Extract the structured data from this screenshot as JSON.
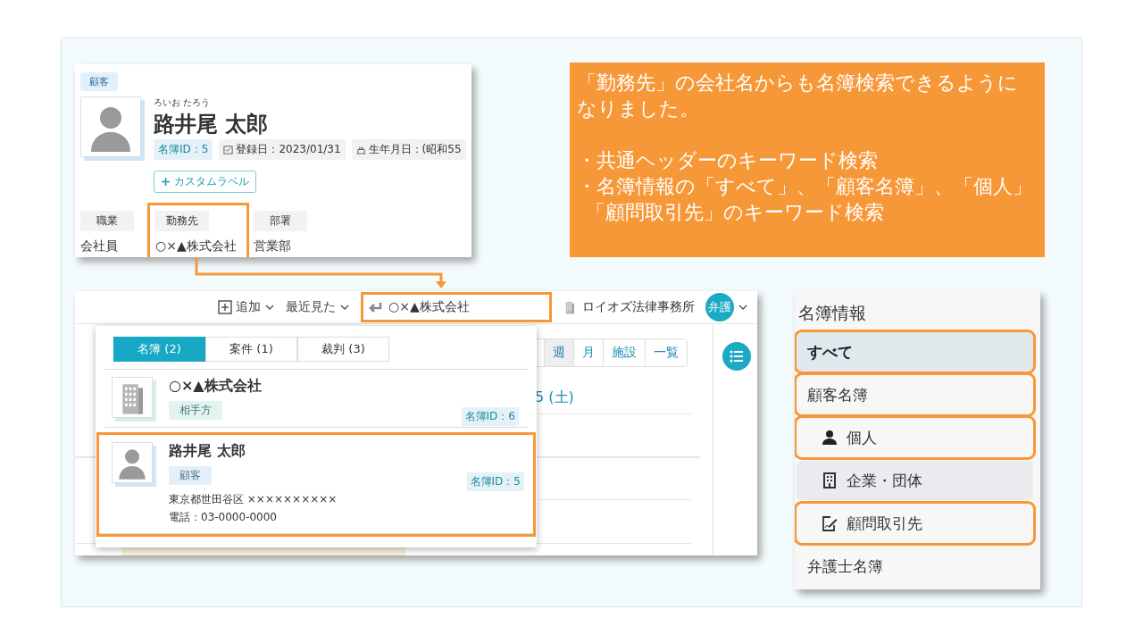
{
  "profile_card": {
    "category_badge": "顧客",
    "furigana": "ろいお たろう",
    "name": "路井尾 太郎",
    "meta": [
      {
        "kind": "id",
        "text": "名簿ID：5"
      },
      {
        "kind": "date",
        "text": "登録日：2023/01/31"
      },
      {
        "kind": "birthday",
        "text": "生年月日：(昭和55"
      }
    ],
    "custom_label_button": "カスタムラベル",
    "fields": [
      {
        "label": "職業",
        "value": "会社員",
        "highlighted": false
      },
      {
        "label": "勤務先",
        "value": "○×▲株式会社",
        "highlighted": true
      },
      {
        "label": "部署",
        "value": "営業部",
        "highlighted": false
      }
    ]
  },
  "callout": {
    "intro": "「勤務先」の会社名からも名簿検索できるようになりました。",
    "bullets": [
      [
        "・共通ヘッダーのキーワード検索"
      ],
      [
        "・名簿情報の「すべて」、「顧客名簿」、「個人」",
        "「顧問取引先」のキーワード検索"
      ]
    ]
  },
  "app_header": {
    "add_menu": "追加",
    "recent_menu": "最近見た",
    "search": {
      "value": "○×▲株式会社",
      "highlighted": true
    },
    "office": "ロイオズ法律事務所",
    "avatar": "弁護"
  },
  "calendar": {
    "views": [
      {
        "label": "週",
        "selected": true
      },
      {
        "label": "月",
        "selected": false
      },
      {
        "label": "施設",
        "selected": false
      },
      {
        "label": "一覧",
        "selected": false
      }
    ],
    "date_heading": "5 (土)"
  },
  "search_dropdown": {
    "tabs": [
      {
        "label": "名簿 (2)",
        "selected": true
      },
      {
        "label": "案件 (1)",
        "selected": false
      },
      {
        "label": "裁判 (3)",
        "selected": false
      }
    ],
    "results": [
      {
        "kind": "company",
        "name": "○×▲株式会社",
        "tag": {
          "text": "相手方",
          "color": "#e3f4ee"
        },
        "id": "名簿ID：6",
        "highlighted": false
      },
      {
        "kind": "person",
        "name": "路井尾 太郎",
        "tag": {
          "text": "顧客",
          "color": "#e3f0fb"
        },
        "id": "名簿ID：5",
        "address": "東京都世田谷区 ××××××××××",
        "phone": "電話：03-0000-0000",
        "highlighted": true
      }
    ]
  },
  "sidebar": {
    "title": "名簿情報",
    "items": [
      {
        "label": "すべて",
        "selected": true,
        "hovered": false,
        "highlighted": true
      },
      {
        "label": "顧客名簿",
        "selected": false,
        "hovered": false,
        "highlighted": true,
        "children": [
          {
            "kind": "person",
            "label": "個人",
            "selected": false,
            "hovered": false,
            "highlighted": true
          },
          {
            "kind": "building",
            "label": "企業・団体",
            "selected": false,
            "hovered": true,
            "highlighted": false
          },
          {
            "kind": "contract",
            "label": "顧問取引先",
            "selected": false,
            "hovered": false,
            "highlighted": true
          }
        ]
      },
      {
        "label": "弁護士名簿",
        "selected": false,
        "hovered": false,
        "highlighted": false
      }
    ]
  }
}
